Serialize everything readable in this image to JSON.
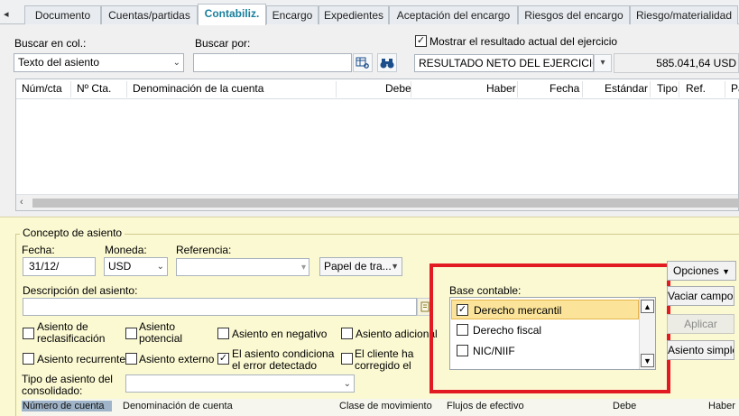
{
  "tabs": [
    {
      "label": "Documento"
    },
    {
      "label": "Cuentas/partidas"
    },
    {
      "label": "Contabiliz.",
      "active": true
    },
    {
      "label": "Encargo"
    },
    {
      "label": "Expedientes"
    },
    {
      "label": "Aceptación del encargo"
    },
    {
      "label": "Riesgos del encargo"
    },
    {
      "label": "Riesgo/materialidad"
    }
  ],
  "search": {
    "column_label": "Buscar en col.:",
    "column_value": "Texto del asiento",
    "by_label": "Buscar por:",
    "by_value": ""
  },
  "result": {
    "show_label": "Mostrar el resultado actual del ejercicio",
    "show_checked": true,
    "select_value": "RESULTADO NETO DEL EJERCICIO hacia",
    "amount": "585.041,64 USD"
  },
  "grid": {
    "columns": [
      "Núm/cta",
      "Nº Cta.",
      "Denominación de la cuenta",
      "Debe",
      "Haber",
      "Fecha",
      "Estándar",
      "Tipo",
      "Ref.",
      "Pa"
    ]
  },
  "concepto": {
    "title": "Concepto de asiento",
    "fecha_label": "Fecha:",
    "fecha_value": "31/12/",
    "moneda_label": "Moneda:",
    "moneda_value": "USD",
    "referencia_label": "Referencia:",
    "referencia_value": "",
    "papel_value": "Papel de tra...",
    "descripcion_label": "Descripción del asiento:",
    "descripcion_value": "",
    "checkboxes": [
      {
        "label": "Asiento de reclasificación",
        "checked": false
      },
      {
        "label": "Asiento potencial",
        "checked": false
      },
      {
        "label": "Asiento en negativo",
        "checked": false
      },
      {
        "label": "Asiento adicional",
        "checked": false
      },
      {
        "label": "Asiento recurrente/",
        "checked": false
      },
      {
        "label": "Asiento externo",
        "checked": false
      },
      {
        "label": "El asiento condiciona el error detectado",
        "checked": true
      },
      {
        "label": "El cliente ha corregido el error",
        "checked": false
      }
    ],
    "tipo_label": "Tipo de asiento del consolidado:",
    "tipo_value": ""
  },
  "base_contable": {
    "label": "Base contable:",
    "items": [
      {
        "label": "Derecho mercantil",
        "checked": true
      },
      {
        "label": "Derecho fiscal",
        "checked": false
      },
      {
        "label": "NIC/NIIF",
        "checked": false
      }
    ]
  },
  "buttons": {
    "opciones": "Opciones",
    "vaciar": "Vaciar campos",
    "aplicar": "Aplicar",
    "asiento_simple": "Asiento simple"
  },
  "bottom_table": {
    "columns": [
      "Número de cuenta",
      "Denominación de cuenta",
      "Clase de movimiento",
      "Flujos de efectivo",
      "Debe",
      "Haber"
    ]
  },
  "colors": {
    "accent": "#1a7f9c",
    "highlight_border": "#e21b23",
    "panel_yellow": "#fbf9d2",
    "selected_item": "#fbe49a"
  }
}
